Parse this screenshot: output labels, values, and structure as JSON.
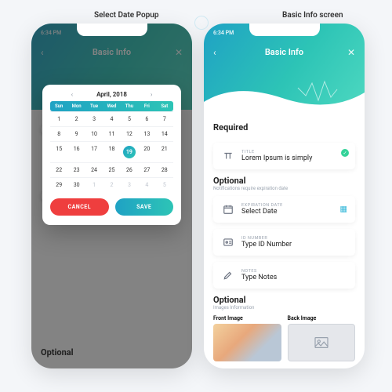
{
  "annotations": {
    "left_label": "Select Date Popup",
    "right_label": "Basic Info screen"
  },
  "header": {
    "time": "6:34 PM",
    "title": "Basic Info"
  },
  "sections": {
    "required": "Required",
    "optional": "Optional",
    "optional_sub_notif": "Notifications require expiration date",
    "optional_images": "Optional",
    "images_sub": "Images Information"
  },
  "fields": {
    "title_label": "TITLE",
    "title_value": "Lorem Ipsum is simply",
    "exp_label": "EXPIRATION DATE",
    "exp_value": "Select Date",
    "id_label": "ID NUMBER",
    "id_value": "Type ID Number",
    "notes_label": "NOTES",
    "notes_value": "Type Notes"
  },
  "images": {
    "front": "Front Image",
    "back": "Back Image"
  },
  "calendar": {
    "month": "April, 2018",
    "dow": [
      "Sun",
      "Mon",
      "Tue",
      "Wed",
      "Thu",
      "Fri",
      "Sat"
    ],
    "selected": 19,
    "leading": [
      1,
      2,
      3,
      4,
      5,
      6,
      7
    ],
    "body": [
      8,
      9,
      10,
      11,
      12,
      13,
      14,
      15,
      16,
      17,
      18,
      19,
      20,
      21,
      22,
      23,
      24,
      25,
      26,
      27,
      28,
      29,
      30
    ],
    "trailing": [
      1,
      2,
      3,
      4,
      5
    ],
    "cancel": "CANCEL",
    "save": "SAVE"
  }
}
